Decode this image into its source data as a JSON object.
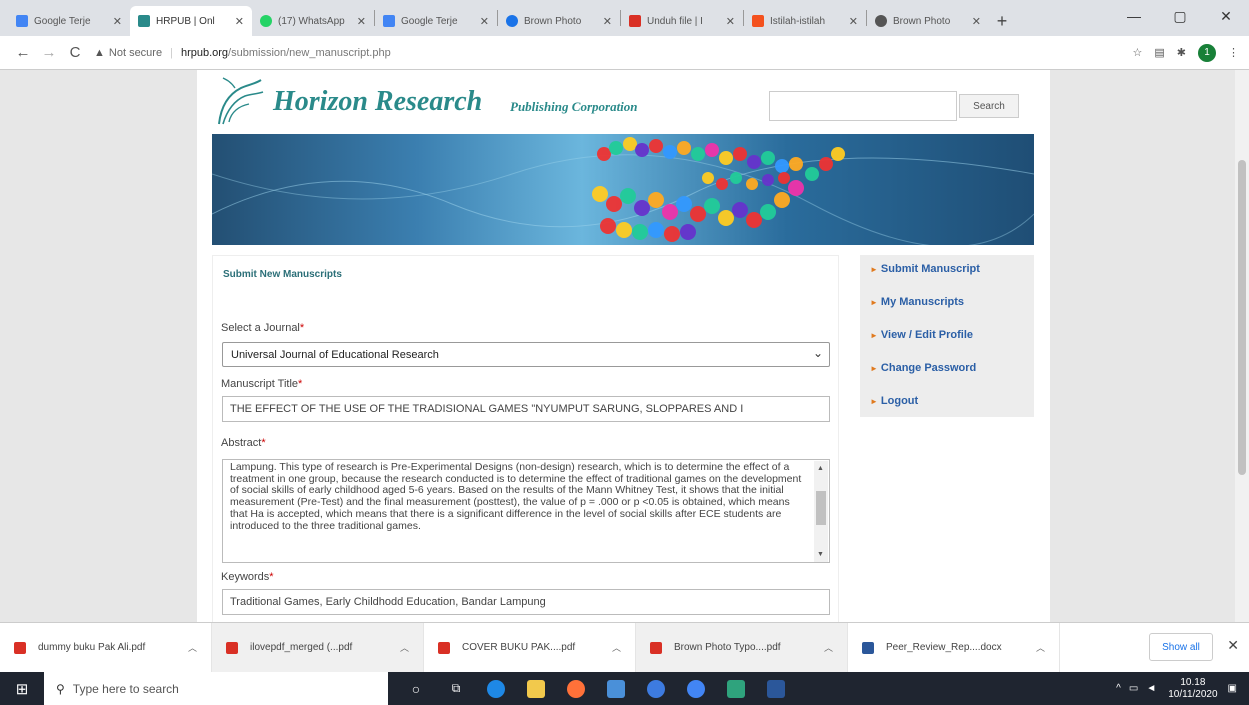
{
  "browser": {
    "tabs": [
      {
        "label": "Google Terje",
        "active": false,
        "color": "#4285f4"
      },
      {
        "label": "HRPUB | Onl",
        "active": true,
        "color": "#2a8a8a"
      },
      {
        "label": "(17) WhatsApp",
        "active": false,
        "color": "#25d366"
      },
      {
        "label": "Google Terje",
        "active": false,
        "color": "#4285f4"
      },
      {
        "label": "Brown Photo",
        "active": false,
        "color": "#1a73e8"
      },
      {
        "label": "Unduh file | I",
        "active": false,
        "color": "#d93025"
      },
      {
        "label": "Istilah-istilah",
        "active": false,
        "color": "#f4511e"
      },
      {
        "label": "Brown Photo",
        "active": false,
        "color": "#555555"
      }
    ],
    "new_tab": "+",
    "window_controls": {
      "minimize": "—",
      "maximize": "▢",
      "close": "✕"
    },
    "nav": {
      "back": "←",
      "forward": "→",
      "reload": "C"
    },
    "address": {
      "security": "Not secure",
      "host": "hrpub.org",
      "path": "/submission/new_manuscript.php"
    },
    "profile_initial": "1"
  },
  "site": {
    "logo_title": "Horizon Research",
    "logo_subtitle": "Publishing Corporation",
    "search_placeholder": "",
    "search_button": "Search"
  },
  "form": {
    "title": "Submit New Manuscripts",
    "journal_label": "Select a Journal",
    "journal_value": "Universal Journal of Educational Research",
    "title_label": "Manuscript Title",
    "title_value": "THE EFFECT OF THE USE OF THE TRADISIONAL GAMES \"NYUMPUT SARUNG, SLOPPARES AND I",
    "abstract_label": "Abstract",
    "abstract_value": "Lampung. This type of research is Pre-Experimental Designs (non-design) research, which is to determine the effect of a treatment in one group, because the research conducted is to determine the effect of traditional games on the development of social skills of early childhood aged 5-6 years. Based on the results of the Mann Whitney Test, it shows that the initial measurement (Pre-Test) and the final measurement (posttest), the value of p = .000 or p <0.05 is obtained, which means that Ha is accepted, which means that there is a significant difference in the level of social skills after ECE students are introduced to the three traditional games.",
    "keywords_label": "Keywords",
    "keywords_value": "Traditional Games, Early Childhodd Education, Bandar Lampung",
    "required_mark": "*"
  },
  "sidebar": {
    "items": [
      {
        "label": "Submit Manuscript"
      },
      {
        "label": "My Manuscripts"
      },
      {
        "label": "View / Edit Profile"
      },
      {
        "label": "Change Password"
      },
      {
        "label": "Logout"
      }
    ]
  },
  "downloads": {
    "items": [
      {
        "name": "dummy buku Pak Ali.pdf"
      },
      {
        "name": "ilovepdf_merged (...pdf"
      },
      {
        "name": "COVER BUKU PAK....pdf"
      },
      {
        "name": "Brown Photo Typo....pdf"
      },
      {
        "name": "Peer_Review_Rep....docx"
      }
    ],
    "show_all": "Show all",
    "close": "✕"
  },
  "taskbar": {
    "search_placeholder": "Type here to search",
    "time": "10.18",
    "date": "10/11/2020"
  },
  "colors": {
    "brand_teal": "#2a8a8a",
    "link_blue": "#2b5fa6",
    "accent_orange": "#e07a1f"
  }
}
